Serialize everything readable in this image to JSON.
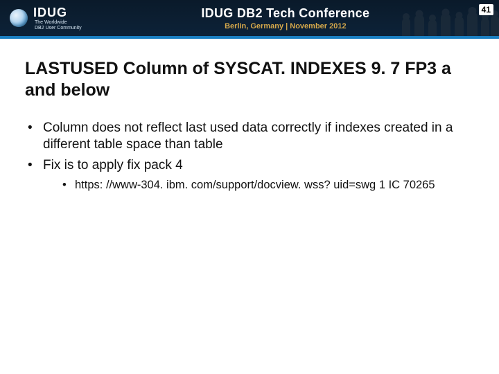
{
  "header": {
    "logo_text": "IDUG",
    "logo_sub_line1": "The Worldwide",
    "logo_sub_line2": "DB2 User Community",
    "conference_title": "IDUG DB2 Tech Conference",
    "conference_sub": "Berlin, Germany  |  November 2012",
    "page_number": "41"
  },
  "slide": {
    "title": "LASTUSED Column of SYSCAT. INDEXES 9. 7 FP3 a and below",
    "bullets": [
      "Column does not reflect last used data correctly if indexes created in a different table space than table",
      "Fix is to apply fix pack 4"
    ],
    "sub_bullets": [
      "https: //www-304. ibm. com/support/docview. wss? uid=swg 1 IC 70265"
    ]
  }
}
